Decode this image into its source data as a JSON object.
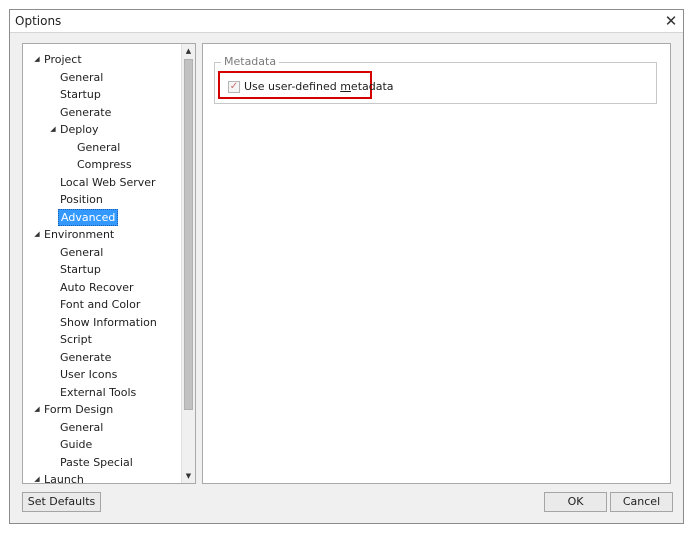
{
  "window": {
    "title": "Options"
  },
  "tree": {
    "items": [
      {
        "label": "Project",
        "level": 0,
        "expanded": true
      },
      {
        "label": "General",
        "level": 1
      },
      {
        "label": "Startup",
        "level": 1
      },
      {
        "label": "Generate",
        "level": 1
      },
      {
        "label": "Deploy",
        "level": 1,
        "expanded": true
      },
      {
        "label": "General",
        "level": 2
      },
      {
        "label": "Compress",
        "level": 2
      },
      {
        "label": "Local Web Server",
        "level": 1
      },
      {
        "label": "Position",
        "level": 1
      },
      {
        "label": "Advanced",
        "level": 1,
        "selected": true
      },
      {
        "label": "Environment",
        "level": 0,
        "expanded": true
      },
      {
        "label": "General",
        "level": 1
      },
      {
        "label": "Startup",
        "level": 1
      },
      {
        "label": "Auto Recover",
        "level": 1
      },
      {
        "label": "Font and Color",
        "level": 1
      },
      {
        "label": "Show Information",
        "level": 1
      },
      {
        "label": "Script",
        "level": 1
      },
      {
        "label": "Generate",
        "level": 1
      },
      {
        "label": "User Icons",
        "level": 1
      },
      {
        "label": "External Tools",
        "level": 1
      },
      {
        "label": "Form Design",
        "level": 0,
        "expanded": true
      },
      {
        "label": "General",
        "level": 1
      },
      {
        "label": "Guide",
        "level": 1
      },
      {
        "label": "Paste Special",
        "level": 1
      },
      {
        "label": "Launch",
        "level": 0,
        "expanded": true
      }
    ]
  },
  "content": {
    "group_title": "Metadata",
    "checkbox": {
      "label_before": "Use user-defined ",
      "label_mnemonic": "m",
      "label_after": "etadata",
      "checked": true
    }
  },
  "buttons": {
    "set_defaults": "Set Defaults",
    "ok": "OK",
    "cancel": "Cancel"
  },
  "colors": {
    "selection": "#3399ff",
    "highlight": "#d40000"
  }
}
